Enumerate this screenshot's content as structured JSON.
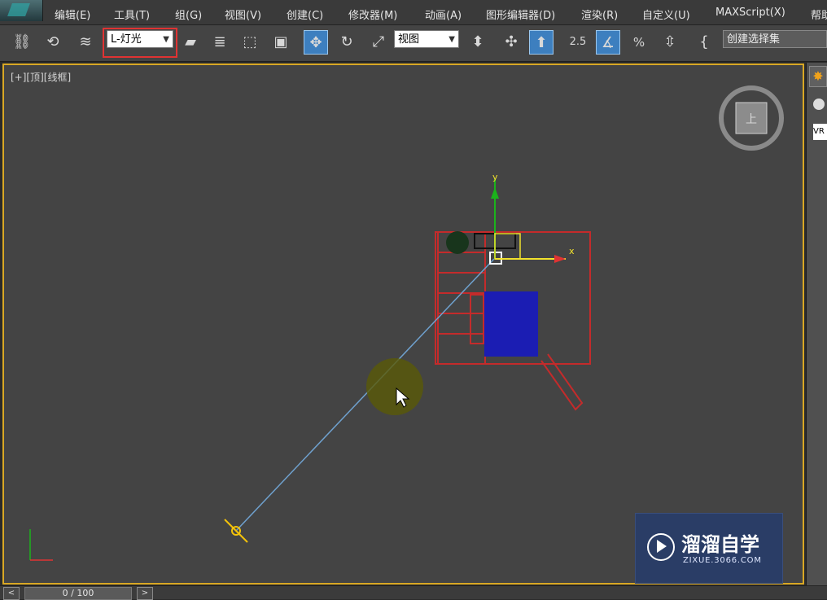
{
  "menus": [
    "编辑(E)",
    "工具(T)",
    "组(G)",
    "视图(V)",
    "创建(C)",
    "修改器(M)",
    "动画(A)",
    "图形编辑器(D)",
    "渲染(R)",
    "自定义(U)",
    "MAXScript(X)",
    "帮助"
  ],
  "toolbar": {
    "filter_select": "L-灯光",
    "view_select": "视图",
    "snap_angle": "2.5",
    "snap_percent": "%",
    "named_sel": "创建选择集"
  },
  "viewport": {
    "label": "[+][顶][线框]",
    "axis_x": "x",
    "axis_y": "y",
    "viewcube_face": "上"
  },
  "cmd_panel": {
    "vr_label": "VR"
  },
  "timeline": {
    "counter": "0 / 100",
    "prev": "<",
    "next": ">"
  },
  "watermark": {
    "title": "溜溜自学",
    "url": "ZIXUE.3066.COM"
  }
}
